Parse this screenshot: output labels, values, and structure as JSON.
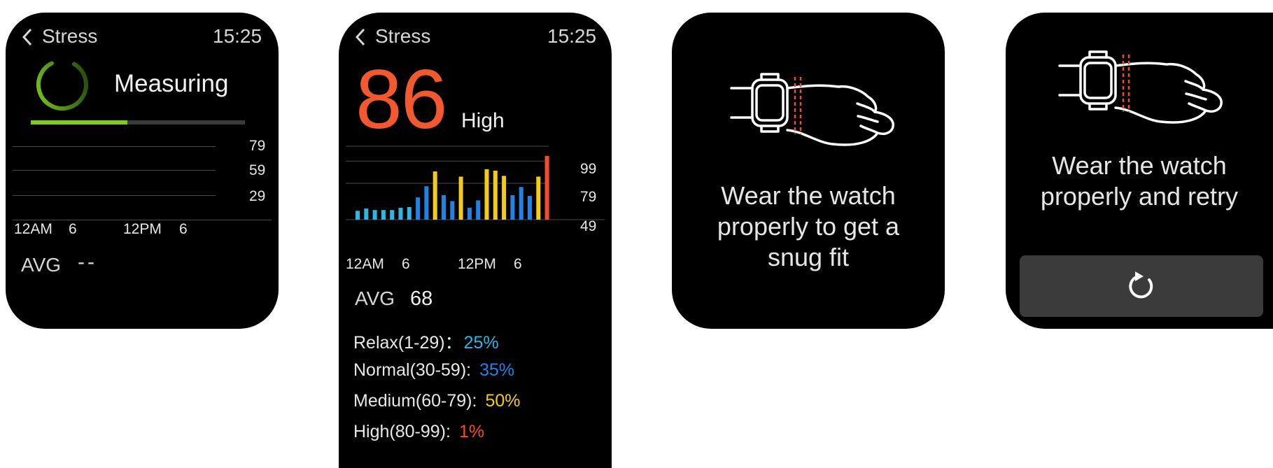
{
  "colors": {
    "relax": "#29b7e6",
    "normal": "#1f83e6",
    "medium": "#f2cc17",
    "high": "#f24b2e",
    "progress": "#7ccd1f"
  },
  "screen_measuring": {
    "back_icon": "chevron-left-icon",
    "title": "Stress",
    "time": "15:25",
    "status": "Measuring",
    "progress": 0.45,
    "y_ticks": [
      "79",
      "59",
      "29"
    ],
    "x_labels": [
      "12AM",
      "6",
      "12PM",
      "6"
    ],
    "avg_label": "AVG",
    "avg_value": "--"
  },
  "screen_result": {
    "back_icon": "chevron-left-icon",
    "title": "Stress",
    "time": "15:25",
    "value": "86",
    "level": "High",
    "y_ticks": [
      "99",
      "79",
      "49"
    ],
    "x_labels": [
      "12AM",
      "6",
      "12PM",
      "6"
    ],
    "avg_label": "AVG",
    "avg_value": "68",
    "breakdown": [
      {
        "label": "Relax(1-29)：",
        "value": "25%"
      },
      {
        "label": "Normal(30-59):",
        "value": "35%"
      },
      {
        "label": "Medium(60-79):",
        "value": "50%"
      },
      {
        "label": "High(80-99):",
        "value": "1%"
      }
    ]
  },
  "chart_data": {
    "type": "bar",
    "ylim": [
      0,
      99
    ],
    "y_ticks": [
      99,
      79,
      49
    ],
    "x_labels": [
      "12AM",
      "6",
      "12PM",
      "6"
    ],
    "values": [
      12,
      15,
      13,
      13,
      13,
      16,
      17,
      30,
      45,
      65,
      33,
      25,
      58,
      16,
      26,
      68,
      66,
      59,
      33,
      44,
      32,
      58,
      86
    ],
    "levels": [
      "relax",
      "relax",
      "relax",
      "relax",
      "relax",
      "relax",
      "relax",
      "normal",
      "normal",
      "medium",
      "normal",
      "normal",
      "medium",
      "normal",
      "normal",
      "medium",
      "medium",
      "medium",
      "normal",
      "normal",
      "normal",
      "medium",
      "high"
    ]
  },
  "screen_fit": {
    "illustration": "watch-on-wrist-icon",
    "message_lines": [
      "Wear the watch",
      "properly to get a",
      "snug fit"
    ]
  },
  "screen_retry": {
    "illustration": "watch-on-wrist-icon",
    "message_lines": [
      "Wear the watch",
      "properly and retry"
    ],
    "retry_icon": "refresh-icon"
  }
}
